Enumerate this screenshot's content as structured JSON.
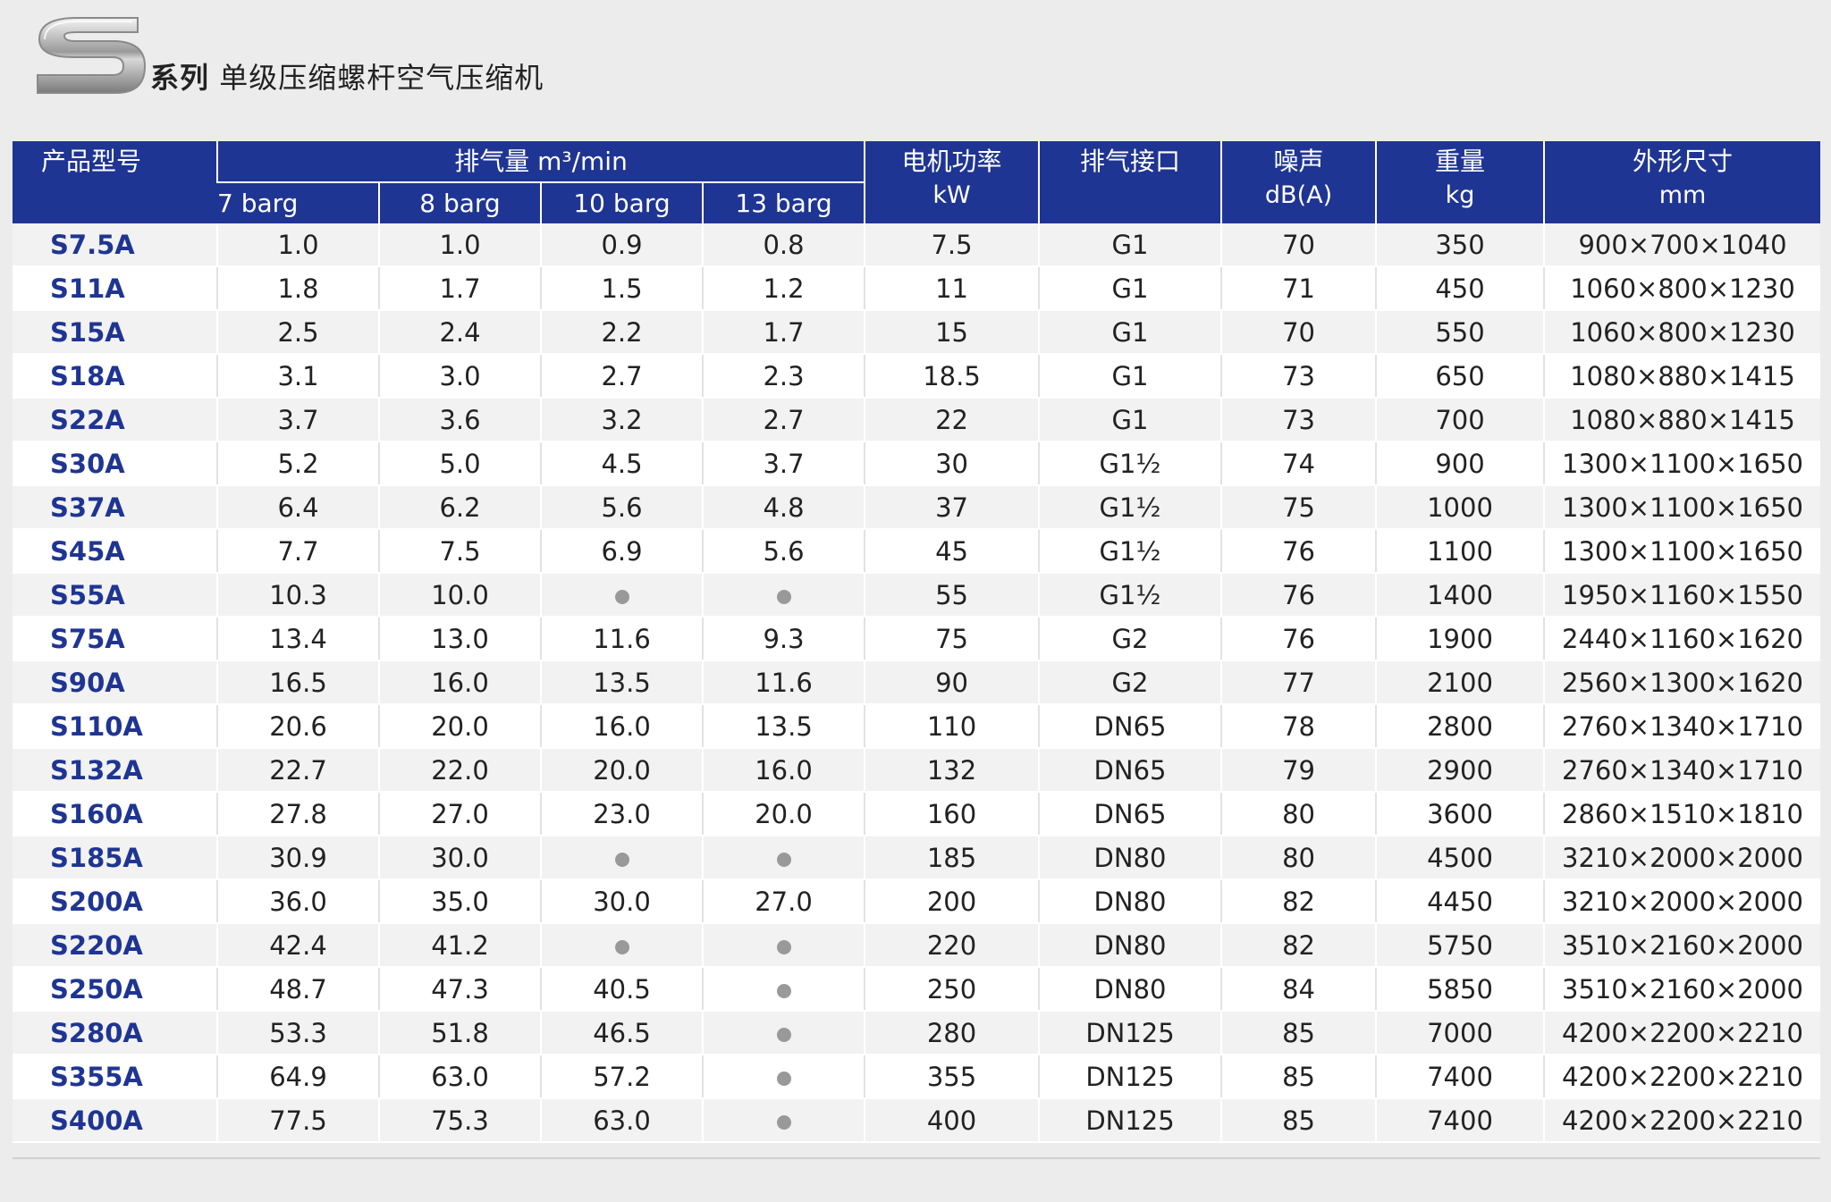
{
  "header": {
    "logo_letter": "S",
    "series_label": "系列",
    "title": "单级压缩螺杆空气压缩机"
  },
  "table": {
    "columns": {
      "model": "产品型号",
      "air_delivery": "排气量 m³/min",
      "air_delivery_sub": [
        "7 barg",
        "8 barg",
        "10 barg",
        "13 barg"
      ],
      "motor_power": "电机功率",
      "motor_power_unit": "kW",
      "outlet": "排气接口",
      "noise": "噪声",
      "noise_unit": "dB(A)",
      "weight": "重量",
      "weight_unit": "kg",
      "dimensions": "外形尺寸",
      "dimensions_unit": "mm"
    },
    "unavailable_marker": "●",
    "rows": [
      {
        "model": "S7.5A",
        "b7": "1.0",
        "b8": "1.0",
        "b10": "0.9",
        "b13": "0.8",
        "power": "7.5",
        "outlet": "G1",
        "noise": "70",
        "weight": "350",
        "dims": "900×700×1040"
      },
      {
        "model": "S11A",
        "b7": "1.8",
        "b8": "1.7",
        "b10": "1.5",
        "b13": "1.2",
        "power": "11",
        "outlet": "G1",
        "noise": "71",
        "weight": "450",
        "dims": "1060×800×1230"
      },
      {
        "model": "S15A",
        "b7": "2.5",
        "b8": "2.4",
        "b10": "2.2",
        "b13": "1.7",
        "power": "15",
        "outlet": "G1",
        "noise": "70",
        "weight": "550",
        "dims": "1060×800×1230"
      },
      {
        "model": "S18A",
        "b7": "3.1",
        "b8": "3.0",
        "b10": "2.7",
        "b13": "2.3",
        "power": "18.5",
        "outlet": "G1",
        "noise": "73",
        "weight": "650",
        "dims": "1080×880×1415"
      },
      {
        "model": "S22A",
        "b7": "3.7",
        "b8": "3.6",
        "b10": "3.2",
        "b13": "2.7",
        "power": "22",
        "outlet": "G1",
        "noise": "73",
        "weight": "700",
        "dims": "1080×880×1415"
      },
      {
        "model": "S30A",
        "b7": "5.2",
        "b8": "5.0",
        "b10": "4.5",
        "b13": "3.7",
        "power": "30",
        "outlet": "G1½",
        "noise": "74",
        "weight": "900",
        "dims": "1300×1100×1650"
      },
      {
        "model": "S37A",
        "b7": "6.4",
        "b8": "6.2",
        "b10": "5.6",
        "b13": "4.8",
        "power": "37",
        "outlet": "G1½",
        "noise": "75",
        "weight": "1000",
        "dims": "1300×1100×1650"
      },
      {
        "model": "S45A",
        "b7": "7.7",
        "b8": "7.5",
        "b10": "6.9",
        "b13": "5.6",
        "power": "45",
        "outlet": "G1½",
        "noise": "76",
        "weight": "1100",
        "dims": "1300×1100×1650"
      },
      {
        "model": "S55A",
        "b7": "10.3",
        "b8": "10.0",
        "b10": "●",
        "b13": "●",
        "power": "55",
        "outlet": "G1½",
        "noise": "76",
        "weight": "1400",
        "dims": "1950×1160×1550"
      },
      {
        "model": "S75A",
        "b7": "13.4",
        "b8": "13.0",
        "b10": "11.6",
        "b13": "9.3",
        "power": "75",
        "outlet": "G2",
        "noise": "76",
        "weight": "1900",
        "dims": "2440×1160×1620"
      },
      {
        "model": "S90A",
        "b7": "16.5",
        "b8": "16.0",
        "b10": "13.5",
        "b13": "11.6",
        "power": "90",
        "outlet": "G2",
        "noise": "77",
        "weight": "2100",
        "dims": "2560×1300×1620"
      },
      {
        "model": "S110A",
        "b7": "20.6",
        "b8": "20.0",
        "b10": "16.0",
        "b13": "13.5",
        "power": "110",
        "outlet": "DN65",
        "noise": "78",
        "weight": "2800",
        "dims": "2760×1340×1710"
      },
      {
        "model": "S132A",
        "b7": "22.7",
        "b8": "22.0",
        "b10": "20.0",
        "b13": "16.0",
        "power": "132",
        "outlet": "DN65",
        "noise": "79",
        "weight": "2900",
        "dims": "2760×1340×1710"
      },
      {
        "model": "S160A",
        "b7": "27.8",
        "b8": "27.0",
        "b10": "23.0",
        "b13": "20.0",
        "power": "160",
        "outlet": "DN65",
        "noise": "80",
        "weight": "3600",
        "dims": "2860×1510×1810"
      },
      {
        "model": "S185A",
        "b7": "30.9",
        "b8": "30.0",
        "b10": "●",
        "b13": "●",
        "power": "185",
        "outlet": "DN80",
        "noise": "80",
        "weight": "4500",
        "dims": "3210×2000×2000"
      },
      {
        "model": "S200A",
        "b7": "36.0",
        "b8": "35.0",
        "b10": "30.0",
        "b13": "27.0",
        "power": "200",
        "outlet": "DN80",
        "noise": "82",
        "weight": "4450",
        "dims": "3210×2000×2000"
      },
      {
        "model": "S220A",
        "b7": "42.4",
        "b8": "41.2",
        "b10": "●",
        "b13": "●",
        "power": "220",
        "outlet": "DN80",
        "noise": "82",
        "weight": "5750",
        "dims": "3510×2160×2000"
      },
      {
        "model": "S250A",
        "b7": "48.7",
        "b8": "47.3",
        "b10": "40.5",
        "b13": "●",
        "power": "250",
        "outlet": "DN80",
        "noise": "84",
        "weight": "5850",
        "dims": "3510×2160×2000"
      },
      {
        "model": "S280A",
        "b7": "53.3",
        "b8": "51.8",
        "b10": "46.5",
        "b13": "●",
        "power": "280",
        "outlet": "DN125",
        "noise": "85",
        "weight": "7000",
        "dims": "4200×2200×2210"
      },
      {
        "model": "S355A",
        "b7": "64.9",
        "b8": "63.0",
        "b10": "57.2",
        "b13": "●",
        "power": "355",
        "outlet": "DN125",
        "noise": "85",
        "weight": "7400",
        "dims": "4200×2200×2210"
      },
      {
        "model": "S400A",
        "b7": "77.5",
        "b8": "75.3",
        "b10": "63.0",
        "b13": "●",
        "power": "400",
        "outlet": "DN125",
        "noise": "85",
        "weight": "7400",
        "dims": "4200×2200×2210"
      }
    ]
  },
  "colors": {
    "header_bg": "#1f3593",
    "model_text": "#1f3593",
    "page_bg": "#ececec",
    "row_odd": "#f2f2f2",
    "row_even": "#ffffff"
  }
}
